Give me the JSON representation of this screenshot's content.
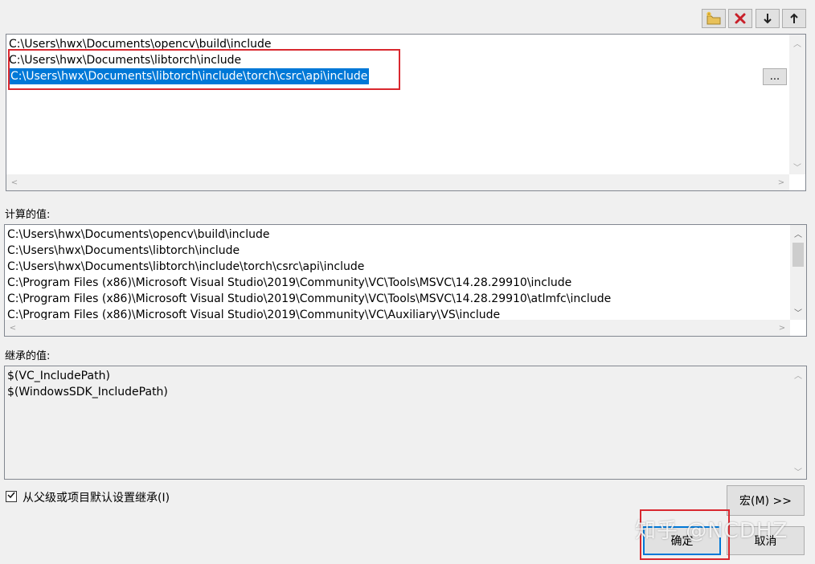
{
  "toolbar": {
    "new_line_icon": "folder-new-icon",
    "delete_icon": "delete-x-icon",
    "move_down_icon": "arrow-down-icon",
    "move_up_icon": "arrow-up-icon"
  },
  "edit_list": {
    "items": [
      "C:\\Users\\hwx\\Documents\\opencv\\build\\include",
      "C:\\Users\\hwx\\Documents\\libtorch\\include",
      "C:\\Users\\hwx\\Documents\\libtorch\\include\\torch\\csrc\\api\\include"
    ],
    "browse_label": "..."
  },
  "evaluated": {
    "label": "计算的值:",
    "items": [
      "C:\\Users\\hwx\\Documents\\opencv\\build\\include",
      "C:\\Users\\hwx\\Documents\\libtorch\\include",
      "C:\\Users\\hwx\\Documents\\libtorch\\include\\torch\\csrc\\api\\include",
      "C:\\Program Files (x86)\\Microsoft Visual Studio\\2019\\Community\\VC\\Tools\\MSVC\\14.28.29910\\include",
      "C:\\Program Files (x86)\\Microsoft Visual Studio\\2019\\Community\\VC\\Tools\\MSVC\\14.28.29910\\atlmfc\\include",
      "C:\\Program Files (x86)\\Microsoft Visual Studio\\2019\\Community\\VC\\Auxiliary\\VS\\include"
    ]
  },
  "inherited": {
    "label": "继承的值:",
    "items": [
      "$(VC_IncludePath)",
      "$(WindowsSDK_IncludePath)"
    ]
  },
  "inherit_checkbox": {
    "label": "从父级或项目默认设置继承(I)",
    "checked": true
  },
  "buttons": {
    "macros": "宏(M) >>",
    "ok": "确定",
    "cancel": "取消"
  },
  "watermark": "知乎 @NCDHZ",
  "colors": {
    "selection": "#0078d7",
    "highlight_box": "#d9282f"
  }
}
